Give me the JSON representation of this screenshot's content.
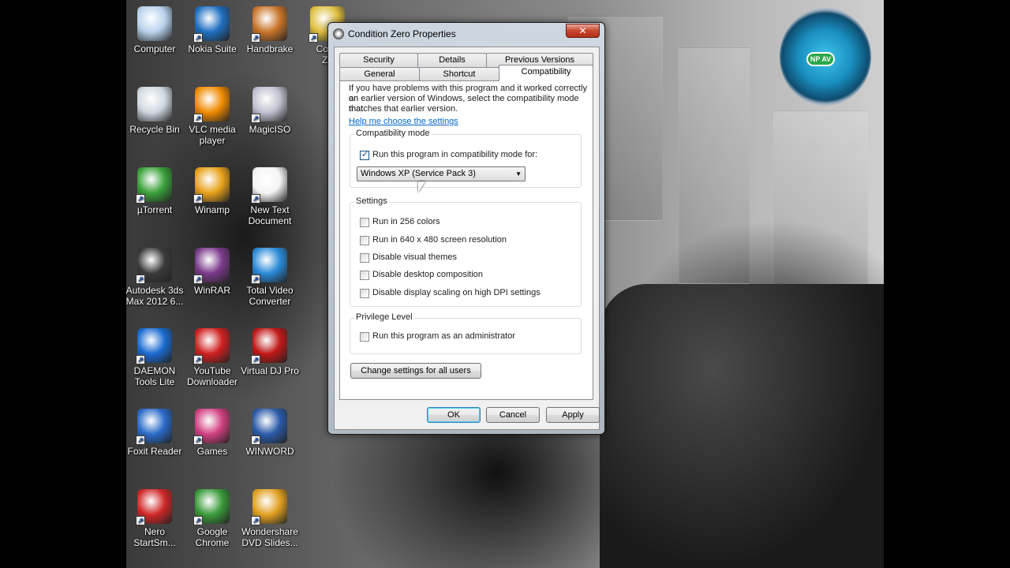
{
  "desktop": {
    "icons": [
      {
        "label": "Computer",
        "icon": "computer-icon",
        "color": "#b9d3ee"
      },
      {
        "label": "Nokia Suite",
        "icon": "nokia-suite-icon",
        "color": "#1f6fc1"
      },
      {
        "label": "Handbrake",
        "icon": "handbrake-icon",
        "color": "#c9752a"
      },
      {
        "label": "Cond\nZe",
        "icon": "condition-zero-icon",
        "color": "#e0c040"
      },
      {
        "label": "Recycle Bin",
        "icon": "recycle-bin-icon",
        "color": "#cfd8e0"
      },
      {
        "label": "VLC media\nplayer",
        "icon": "vlc-icon",
        "color": "#f08a00"
      },
      {
        "label": "MagicISO",
        "icon": "magiciso-icon",
        "color": "#c0c0d0"
      },
      {
        "label": "µTorrent",
        "icon": "utorrent-icon",
        "color": "#3aa13a"
      },
      {
        "label": "Winamp",
        "icon": "winamp-icon",
        "color": "#e8a21a"
      },
      {
        "label": "New Text\nDocument",
        "icon": "text-document-icon",
        "color": "#f4f4f4"
      },
      {
        "label": "Autodesk 3ds\nMax 2012 6...",
        "icon": "3dsmax-icon",
        "color": "#3a3a3a"
      },
      {
        "label": "WinRAR",
        "icon": "winrar-icon",
        "color": "#7a3a8a"
      },
      {
        "label": "Total Video\nConverter",
        "icon": "total-video-converter-icon",
        "color": "#2a8ad8"
      },
      {
        "label": "DAEMON\nTools Lite",
        "icon": "daemon-tools-icon",
        "color": "#1a6ad0"
      },
      {
        "label": "YouTube\nDownloader",
        "icon": "youtube-downloader-icon",
        "color": "#d02020"
      },
      {
        "label": "Virtual DJ Pro",
        "icon": "virtual-dj-icon",
        "color": "#c01818"
      },
      {
        "label": "Foxit Reader",
        "icon": "foxit-reader-icon",
        "color": "#2a6ac8"
      },
      {
        "label": "Games",
        "icon": "games-icon",
        "color": "#d04080"
      },
      {
        "label": "WINWORD",
        "icon": "winword-icon",
        "color": "#2a5aa8"
      },
      {
        "label": "Nero\nStartSm...",
        "icon": "nero-icon",
        "color": "#d02828"
      },
      {
        "label": "Google\nChrome",
        "icon": "chrome-icon",
        "color": "#3a9a3a"
      },
      {
        "label": "Wondershare\nDVD Slides...",
        "icon": "wondershare-icon",
        "color": "#e0a020"
      }
    ],
    "gadget_label": "NP AV"
  },
  "dialog": {
    "title": "Condition Zero Properties",
    "close_label": "✕",
    "tabs_row1": [
      "Security",
      "Details",
      "Previous Versions"
    ],
    "tabs_row2": [
      "General",
      "Shortcut",
      "Compatibility"
    ],
    "intro_line1": "If you have problems with this program and it worked correctly on",
    "intro_line2": "an earlier version of Windows, select the compatibility mode that",
    "intro_line3": "matches that earlier version.",
    "help_link": "Help me choose the settings",
    "compat_group": "Compatibility mode",
    "compat_checkbox": "Run this program in compatibility mode for:",
    "compat_select": "Windows XP (Service Pack 3)",
    "settings_group": "Settings",
    "settings": [
      "Run in 256 colors",
      "Run in 640 x 480 screen resolution",
      "Disable visual themes",
      "Disable desktop composition",
      "Disable display scaling on high DPI settings"
    ],
    "privilege_group": "Privilege Level",
    "privilege_checkbox": "Run this program as an administrator",
    "change_all_button": "Change settings for all users",
    "ok": "OK",
    "cancel": "Cancel",
    "apply": "Apply"
  }
}
